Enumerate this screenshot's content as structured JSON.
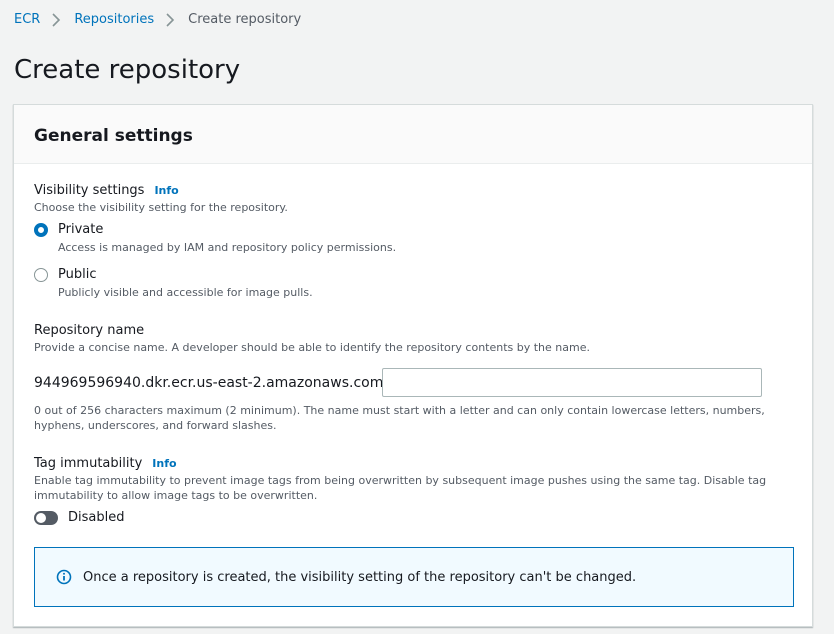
{
  "breadcrumb": {
    "items": [
      "ECR",
      "Repositories"
    ],
    "current": "Create repository"
  },
  "page": {
    "title": "Create repository"
  },
  "general_settings": {
    "title": "General settings",
    "visibility": {
      "label": "Visibility settings",
      "info": "Info",
      "description": "Choose the visibility setting for the repository.",
      "options": [
        {
          "label": "Private",
          "description": "Access is managed by IAM and repository policy permissions.",
          "selected": true
        },
        {
          "label": "Public",
          "description": "Publicly visible and accessible for image pulls.",
          "selected": false
        }
      ]
    },
    "repository_name": {
      "label": "Repository name",
      "description": "Provide a concise name. A developer should be able to identify the repository contents by the name.",
      "prefix": "944969596940.dkr.ecr.us-east-2.amazonaws.com/",
      "value": "",
      "constraint_line1": "0 out of 256 characters maximum (2 minimum). The name must start with a letter and can only contain lowercase letters, numbers,",
      "constraint_line2": "hyphens, underscores, and forward slashes."
    },
    "tag_immutability": {
      "label": "Tag immutability",
      "info": "Info",
      "description_line1": "Enable tag immutability to prevent image tags from being overwritten by subsequent image pushes using the same tag. Disable tag",
      "description_line2": "immutability to allow image tags to be overwritten.",
      "toggle_label": "Disabled",
      "enabled": false
    },
    "alert": {
      "text": "Once a repository is created, the visibility setting of the repository can't be changed."
    }
  },
  "colors": {
    "link": "#0073bb",
    "text": "#16191f",
    "secondary_text": "#545b64",
    "background": "#f2f3f3",
    "alert_background": "#f1faff"
  },
  "icons": {
    "breadcrumb_separator": "chevron-right-icon",
    "alert": "info-circle-icon"
  }
}
